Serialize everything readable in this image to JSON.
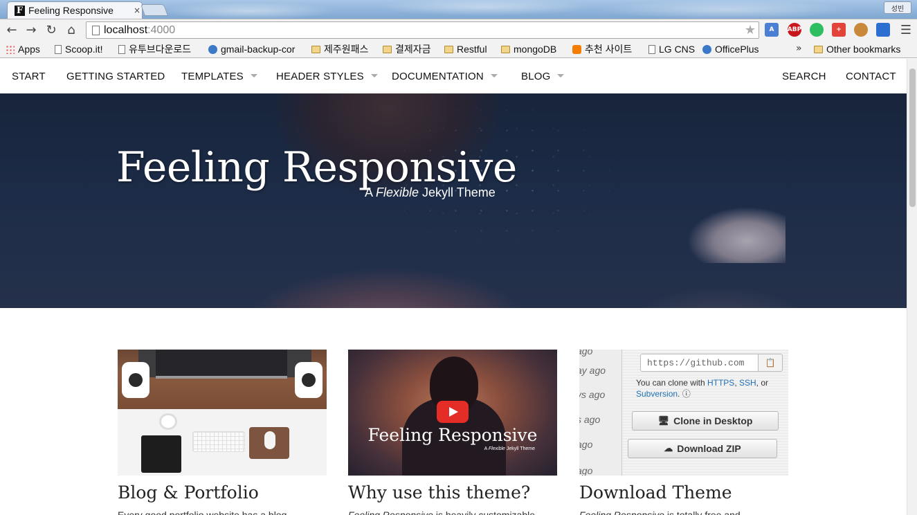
{
  "browser": {
    "tab_title": "Feeling Responsive",
    "tab_favicon_letter": "F",
    "tab_close": "×",
    "profile_label": "성빈",
    "address_host": "localhost",
    "address_port": ":4000",
    "nav_icons": [
      "back-arrow-icon",
      "forward-arrow-icon",
      "reload-icon",
      "home-icon"
    ],
    "extensions": [
      {
        "name": "translate-extension-icon",
        "label": "A",
        "color": "#4a7fd4"
      },
      {
        "name": "adblock-plus-icon",
        "label": "ABP",
        "color": "#c8161d"
      },
      {
        "name": "evernote-web-clipper-icon",
        "label": "",
        "color": "#2dbe60"
      },
      {
        "name": "plus-extension-icon",
        "label": "+",
        "color": "#e2443a"
      },
      {
        "name": "cookie-extension-icon",
        "label": "",
        "color": "#c8893a"
      },
      {
        "name": "shield-extension-icon",
        "label": "",
        "color": "#2d6fd0"
      }
    ]
  },
  "bookmarks": {
    "items": [
      {
        "label": "Apps",
        "icon": "apps"
      },
      {
        "label": "Scoop.it!",
        "icon": "page"
      },
      {
        "label": "유투브다운로드",
        "icon": "page"
      },
      {
        "label": "gmail-backup-cor",
        "icon": "round"
      },
      {
        "label": "제주원패스",
        "icon": "folder"
      },
      {
        "label": "결제자금",
        "icon": "folder"
      },
      {
        "label": "Restful",
        "icon": "folder"
      },
      {
        "label": "mongoDB",
        "icon": "folder"
      },
      {
        "label": "추천 사이트",
        "icon": "blogger"
      },
      {
        "label": "LG CNS",
        "icon": "page"
      },
      {
        "label": "OfficePlus",
        "icon": "round"
      }
    ],
    "overflow": "»",
    "other": "Other bookmarks"
  },
  "site_nav": {
    "left": [
      {
        "label": "START",
        "dropdown": false
      },
      {
        "label": "GETTING STARTED",
        "dropdown": false
      },
      {
        "label": "TEMPLATES",
        "dropdown": true
      },
      {
        "label": "HEADER STYLES",
        "dropdown": true
      },
      {
        "label": "DOCUMENTATION",
        "dropdown": true
      },
      {
        "label": "BLOG",
        "dropdown": true
      }
    ],
    "right": [
      {
        "label": "SEARCH"
      },
      {
        "label": "CONTACT"
      }
    ]
  },
  "hero": {
    "title": "Feeling Responsive",
    "subtitle_pre": "A ",
    "subtitle_em": "Flexible",
    "subtitle_post": " Jekyll Theme"
  },
  "cards": [
    {
      "title": "Blog & Portfolio",
      "text_em": "",
      "text": "Every good portfolio website has a blog."
    },
    {
      "title": "Why use this theme?",
      "text_em": "Feeling Responsive",
      "text": " is heavily customizable",
      "video": {
        "title": "Feeling Responsive",
        "sub_pre": "A ",
        "sub_em": "Flexible",
        "sub_post": " Jekyll Theme"
      }
    },
    {
      "title": "Download Theme",
      "text_em": "Feeling Responsive",
      "text": " is totally free and",
      "github": {
        "ago": [
          "ay ago",
          "ys ago",
          "s ago",
          "ago",
          "ago"
        ],
        "url": "https://github.com",
        "clone_pre": "You can clone with ",
        "https": "HTTPS",
        "comma": ", ",
        "ssh": "SSH",
        "or": ", or ",
        "subversion": "Subversion",
        "clone_post": ". ⓘ",
        "clone_desktop": "Clone in Desktop",
        "download_zip": "Download ZIP"
      }
    }
  ]
}
